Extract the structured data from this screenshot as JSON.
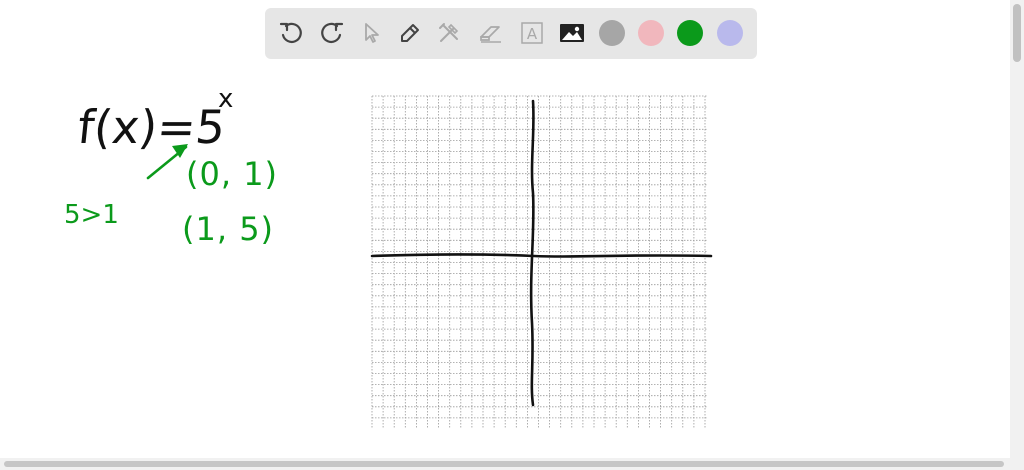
{
  "toolbar": {
    "tools": [
      {
        "icon": "undo-icon",
        "label": "Undo"
      },
      {
        "icon": "redo-icon",
        "label": "Redo"
      },
      {
        "icon": "select-pointer-icon",
        "label": "Select"
      },
      {
        "icon": "pen-icon",
        "label": "Pen"
      },
      {
        "icon": "tools-icon",
        "label": "Tools"
      },
      {
        "icon": "eraser-icon",
        "label": "Eraser"
      },
      {
        "icon": "text-box-icon",
        "label": "Text",
        "glyph": "A"
      },
      {
        "icon": "image-icon",
        "label": "Image"
      }
    ],
    "colors": [
      {
        "name": "gray",
        "hex": "#a6a6a6"
      },
      {
        "name": "pink",
        "hex": "#f1b7bd"
      },
      {
        "name": "green",
        "hex": "#0b9a1b",
        "selected": true
      },
      {
        "name": "lavender",
        "hex": "#b9b9ec"
      }
    ]
  },
  "canvas": {
    "function_text": "f(x)=5",
    "exponent_text": "x",
    "point_1": "(0, 1)",
    "point_2": "(1, 5)",
    "comparison": "5>1",
    "ink_black": "#111111",
    "ink_green": "#0b9a1b",
    "grid_color": "#9a9a9a"
  }
}
